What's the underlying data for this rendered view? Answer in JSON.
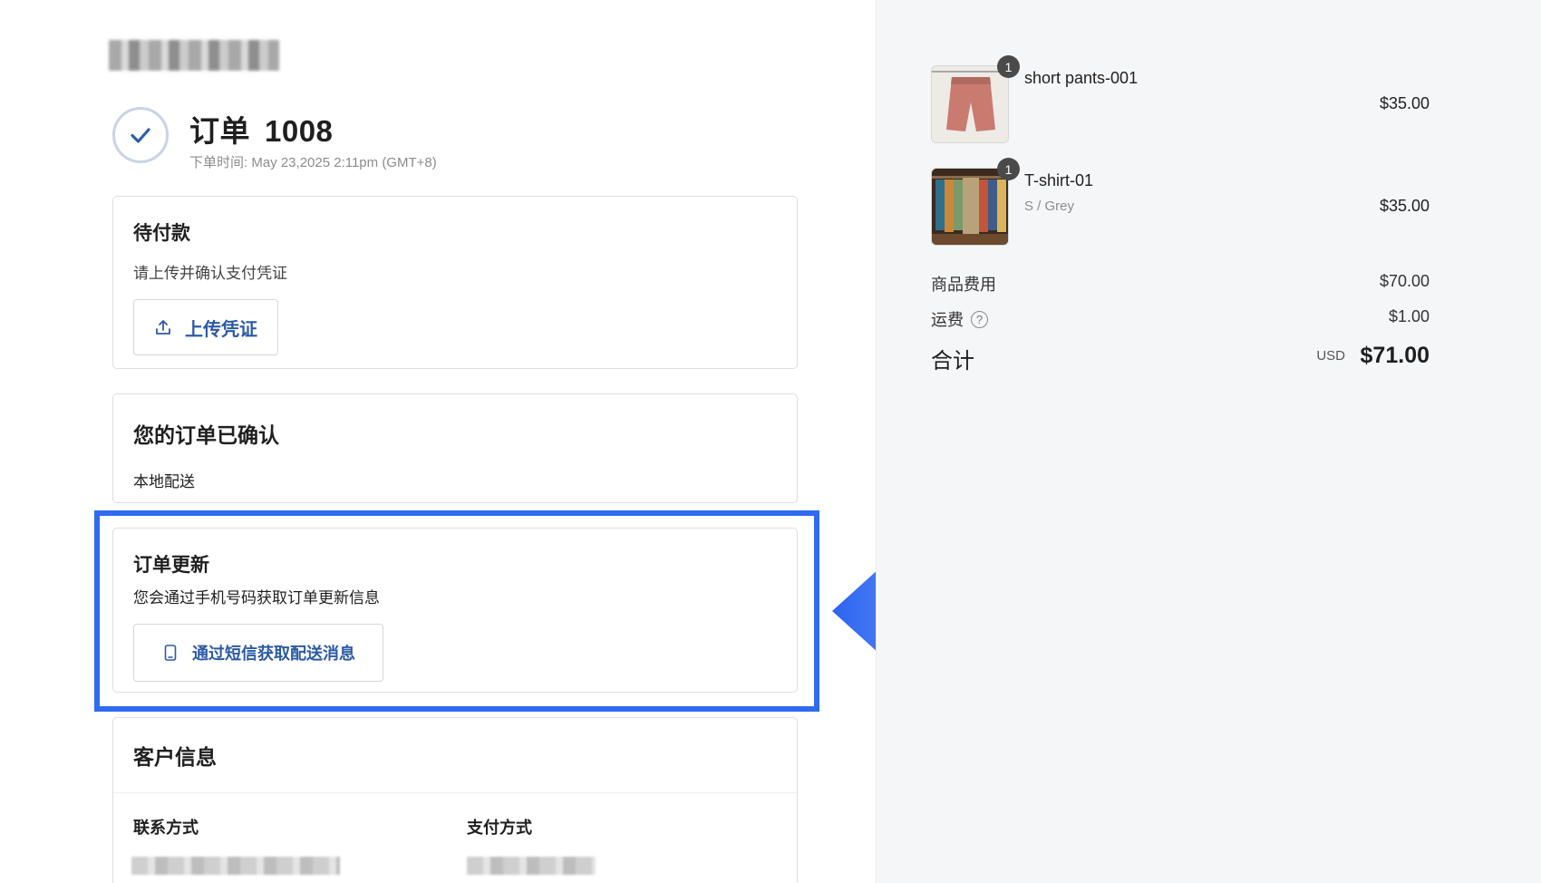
{
  "order": {
    "title": "订单",
    "number": "1008",
    "time": "下单时间: May 23,2025 2:11pm (GMT+8)"
  },
  "payment_card": {
    "title": "待付款",
    "text": "请上传并确认支付凭证",
    "button_label": "上传凭证"
  },
  "confirm_card": {
    "title": "您的订单已确认",
    "text": "本地配送"
  },
  "update_card": {
    "title": "订单更新",
    "text": "您会通过手机号码获取订单更新信息",
    "button_label": "通过短信获取配送消息"
  },
  "customer_card": {
    "title": "客户信息",
    "contact_label": "联系方式",
    "payment_label": "支付方式"
  },
  "cart": {
    "items": [
      {
        "qty": "1",
        "name": "short pants-001",
        "variant": "",
        "price": "$35.00",
        "thumb_icon": "shorts-image"
      },
      {
        "qty": "1",
        "name": "T-shirt-01",
        "variant": "S / Grey",
        "price": "$35.00",
        "thumb_icon": "shirts-rack-image"
      }
    ],
    "subtotal_label": "商品费用",
    "subtotal_value": "$70.00",
    "shipping_label": "运费",
    "shipping_value": "$1.00",
    "total_label": "合计",
    "total_currency": "USD",
    "total_value": "$71.00"
  },
  "colors": {
    "accent": "#2c5aa6",
    "highlight": "#2e6bf0"
  }
}
